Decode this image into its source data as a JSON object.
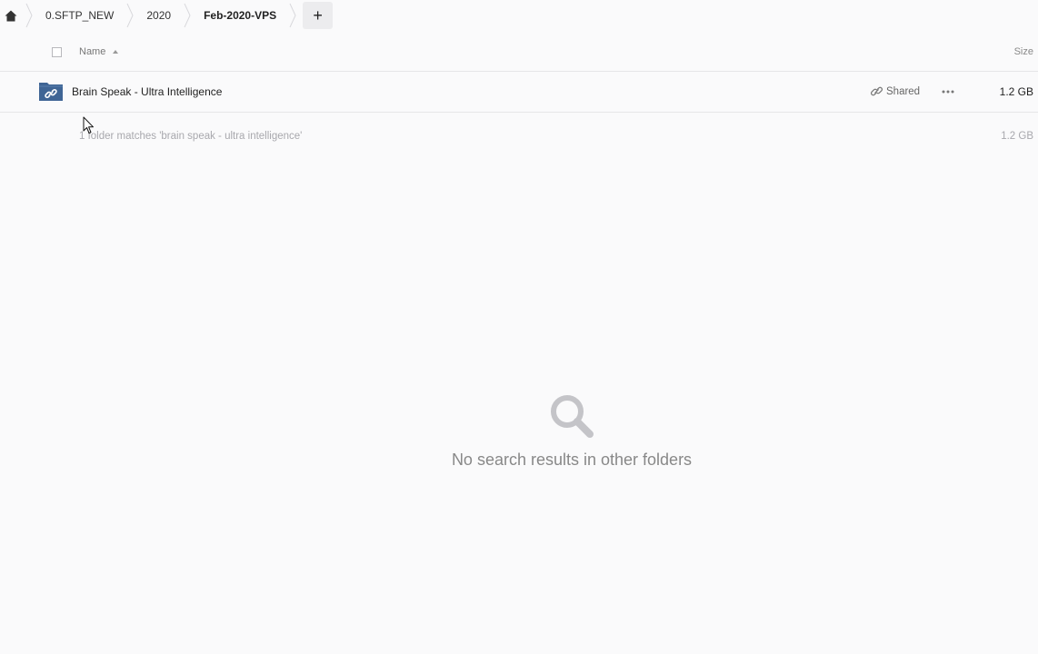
{
  "breadcrumb": {
    "home_icon": "home-icon",
    "items": [
      {
        "label": "0.SFTP_NEW"
      },
      {
        "label": "2020"
      },
      {
        "label": "Feb-2020-VPS"
      }
    ],
    "add_label": "+"
  },
  "list_header": {
    "name_label": "Name",
    "size_label": "Size",
    "sort": "ascending"
  },
  "rows": [
    {
      "name": "Brain Speak - Ultra Intelligence",
      "type": "shared-folder",
      "share_label": "Shared",
      "size": "1.2 GB"
    }
  ],
  "summary": {
    "text": "1 folder matches 'brain speak - ultra intelligence'",
    "size": "1.2 GB"
  },
  "empty_state": {
    "icon": "search-icon",
    "text": "No search results in other folders"
  },
  "colors": {
    "folder": "#3f6595",
    "background": "#fafafb",
    "muted_text": "#a8a8ad"
  }
}
